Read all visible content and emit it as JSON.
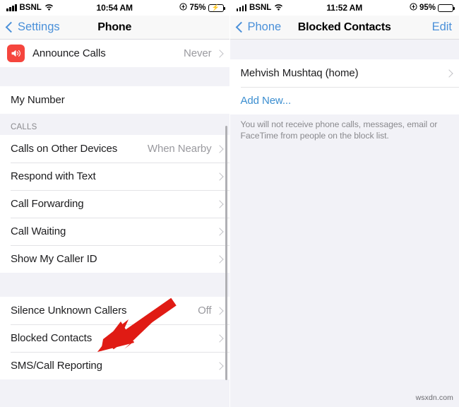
{
  "left_panel": {
    "status_bar": {
      "carrier": "BSNL",
      "time": "10:54 AM",
      "battery_percent": "75%",
      "battery_state": "charging",
      "signal_icon": "signal-bars-icon",
      "wifi_icon": "wifi-icon",
      "orientation_lock_icon": "rotation-lock-icon"
    },
    "nav": {
      "back_label": "Settings",
      "title": "Phone",
      "back_icon": "chevron-left-icon"
    },
    "announce_group": {
      "icon_name": "speaker-waves-icon",
      "icon_color": "#f5453d",
      "label": "Announce Calls",
      "value": "Never"
    },
    "my_number_group": {
      "label": "My Number"
    },
    "calls_section": {
      "header": "CALLS",
      "rows": [
        {
          "label": "Calls on Other Devices",
          "value": "When Nearby"
        },
        {
          "label": "Respond with Text",
          "value": ""
        },
        {
          "label": "Call Forwarding",
          "value": ""
        },
        {
          "label": "Call Waiting",
          "value": ""
        },
        {
          "label": "Show My Caller ID",
          "value": ""
        }
      ]
    },
    "blocking_section": {
      "rows": [
        {
          "label": "Silence Unknown Callers",
          "value": "Off"
        },
        {
          "label": "Blocked Contacts",
          "value": ""
        },
        {
          "label": "SMS/Call Reporting",
          "value": ""
        }
      ]
    },
    "annotation": {
      "type": "arrow",
      "color": "#e01b14",
      "points_to": "Blocked Contacts"
    }
  },
  "right_panel": {
    "status_bar": {
      "carrier": "BSNL",
      "time": "11:52 AM",
      "battery_percent": "95%",
      "battery_state": "full",
      "signal_icon": "signal-bars-icon",
      "wifi_icon": "wifi-icon",
      "orientation_lock_icon": "rotation-lock-icon"
    },
    "nav": {
      "back_label": "Phone",
      "title": "Blocked Contacts",
      "edit_label": "Edit",
      "back_icon": "chevron-left-icon"
    },
    "blocked_list": {
      "contacts": [
        {
          "label": "Mehvish Mushtaq (home)"
        }
      ],
      "add_new_label": "Add New...",
      "footnote": "You will not receive phone calls, messages, email or FaceTime from people on the block list."
    }
  },
  "watermark": "wsxdn.com"
}
